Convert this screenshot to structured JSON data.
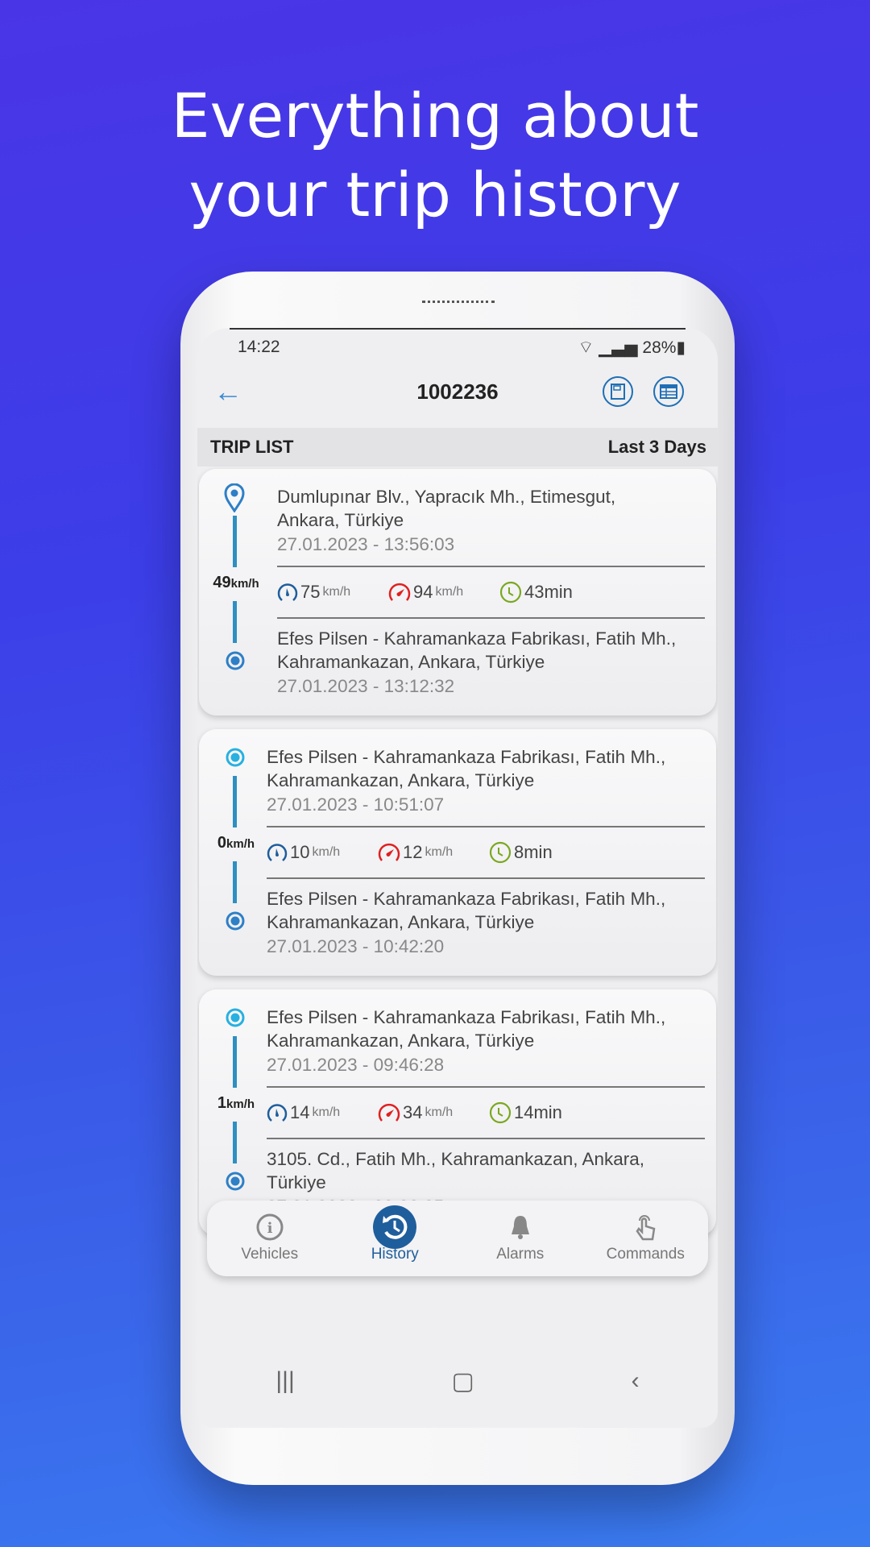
{
  "headline": {
    "line1": "Everything about",
    "line2": "your trip history"
  },
  "status_bar": {
    "time": "14:22",
    "battery": "28%"
  },
  "header": {
    "title": "1002236",
    "back_icon": "arrow-left-icon",
    "actions": [
      "save-icon",
      "table-icon"
    ]
  },
  "trip_list": {
    "label": "TRIP LIST",
    "range": "Last 3 Days"
  },
  "trips": [
    {
      "start_address": [
        "Dumlupınar Blv., Yapracık Mh., Etimesgut,",
        "Ankara, Türkiye"
      ],
      "start_time": "27.01.2023 - 13:56:03",
      "speed": "49",
      "speed_unit": "km/h",
      "avg_speed": "75",
      "max_speed": "94",
      "unit": "km/h",
      "duration": "43min",
      "end_address": [
        "Efes Pilsen - Kahramankaza Fabrikası, Fatih Mh.,",
        "Kahramankazan, Ankara, Türkiye"
      ],
      "end_time": "27.01.2023 - 13:12:32",
      "start_icon": "map-pin-icon"
    },
    {
      "start_address": [
        "Efes Pilsen - Kahramankaza Fabrikası, Fatih Mh.,",
        "Kahramankazan, Ankara, Türkiye"
      ],
      "start_time": "27.01.2023 - 10:51:07",
      "speed": "0",
      "speed_unit": "km/h",
      "avg_speed": "10",
      "max_speed": "12",
      "unit": "km/h",
      "duration": "8min",
      "end_address": [
        "Efes Pilsen - Kahramankaza Fabrikası, Fatih Mh.,",
        "Kahramankazan, Ankara, Türkiye"
      ],
      "end_time": "27.01.2023 - 10:42:20",
      "start_icon": "dot-icon"
    },
    {
      "start_address": [
        "Efes Pilsen - Kahramankaza Fabrikası, Fatih Mh.,",
        "Kahramankazan, Ankara, Türkiye"
      ],
      "start_time": "27.01.2023 - 09:46:28",
      "speed": "1",
      "speed_unit": "km/h",
      "avg_speed": "14",
      "max_speed": "34",
      "unit": "km/h",
      "duration": "14min",
      "end_address": [
        "3105. Cd., Fatih Mh., Kahramankazan, Ankara,",
        "Türkiye"
      ],
      "end_time": "27.01.2023 - 09:32:25",
      "start_icon": "dot-icon"
    }
  ],
  "bottom_nav": [
    {
      "label": "Vehicles",
      "icon": "info-icon"
    },
    {
      "label": "History",
      "icon": "history-icon",
      "active": true
    },
    {
      "label": "Alarms",
      "icon": "bell-icon"
    },
    {
      "label": "Commands",
      "icon": "hand-pointer-icon"
    }
  ],
  "colors": {
    "accent": "#1f5e9c",
    "timeline": "#2e8fc0",
    "avg_speed": "#1f5e9c",
    "max_speed": "#e02020",
    "duration": "#7aa820"
  }
}
